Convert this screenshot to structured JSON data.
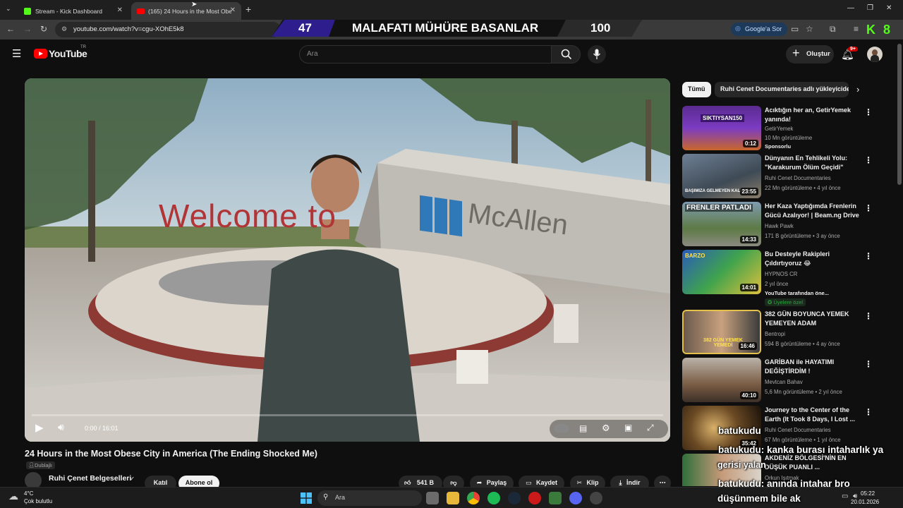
{
  "browser": {
    "tabs": [
      {
        "label": "Stream - Kick Dashboard",
        "active": false
      },
      {
        "label": "(165) 24 Hours in the Most Obe",
        "active": true
      }
    ],
    "url": "youtube.com/watch?v=cgu-XOhE5k8",
    "sor_button": "Google'a Sor"
  },
  "overlay_banner": {
    "left_value": "47",
    "text": "MALAFATI MÜHÜRE BASANLAR",
    "right_value": "100"
  },
  "youtube": {
    "logo": "YouTube",
    "region": "TR",
    "search_placeholder": "Ara",
    "create_label": "Oluştur",
    "notification_count": "9+"
  },
  "player": {
    "time": "0:00 / 16:01",
    "scene_text_left": "Welcome to",
    "scene_text_right": "McAllen"
  },
  "video": {
    "title": "24 Hours in the Most Obese City in America (The Ending Shocked Me)",
    "dubbed_label": "Dublajlı",
    "channel": "Ruhi Çenet Belgeselleri",
    "join_label": "Katıl",
    "subscribe_label": "Abone ol",
    "likes": "541 B",
    "share_label": "Paylaş",
    "save_label": "Kaydet",
    "clip_label": "Klip",
    "download_label": "İndir"
  },
  "sidebar": {
    "chips": [
      "Tümü",
      "Ruhi Cenet Documentaries adlı yükleyiciden"
    ],
    "recommendations": [
      {
        "title": "Acıktığın her an, GetirYemek yanında!",
        "channel": "GetirYemek",
        "meta": "10 Mn görüntüleme",
        "extra": "Sponsorlu",
        "duration": "0:12"
      },
      {
        "title": "Dünyanın En Tehlikeli Yolu: \"Karakurum Ölüm Geçidi\"",
        "channel": "Ruhi Cenet Documentaries",
        "meta": "22 Mn görüntüleme • 4 yıl önce",
        "extra": "",
        "duration": "23:55"
      },
      {
        "title": "Her Kaza Yaptığımda Frenlerin Gücü Azalıyor! | Beam.ng Drive",
        "channel": "Hawk Pawk",
        "meta": "171 B görüntüleme • 3 ay önce",
        "extra": "",
        "duration": "14:33"
      },
      {
        "title": "Bu Desteyle Rakipleri Çıldırtıyoruz 😂",
        "channel": "HYPNOS CR",
        "meta": "2 yıl önce",
        "extra": "YouTube tarafından öne...",
        "badge": "Üyelere özel",
        "duration": "14:01"
      },
      {
        "title": "382 GÜN BOYUNCA YEMEK YEMEYEN ADAM",
        "channel": "Bentropi",
        "meta": "594 B görüntüleme • 4 ay önce",
        "extra": "",
        "duration": "16:46"
      },
      {
        "title": "GARİBAN ile HAYATIMI DEĞİŞTİRDİM !",
        "channel": "Mevtcan Bahav",
        "meta": "5,6 Mn görüntüleme • 2 yıl önce",
        "extra": "",
        "duration": "40:10"
      },
      {
        "title": "Journey to the Center of the Earth (It Took 8 Days, I Lost ...",
        "channel": "Ruhi Cenet Documentaries",
        "meta": "67 Mn görüntüleme • 1 yıl önce",
        "extra": "",
        "duration": "35:42"
      },
      {
        "title": "AKDENİZ BÖLGESİ'NİN EN DÜŞÜK PUANLI ...",
        "channel": "Orkun Işıtmak",
        "meta": "",
        "extra": "",
        "duration": ""
      }
    ],
    "thumb_texts": [
      "SIKTIYSAN150",
      "BAŞIMIZA GELMEYEN KALMADI",
      "FRENLER PATLADI",
      "BARZO",
      "382 GÜN YEMEK YEMEDİ",
      "",
      "",
      ""
    ]
  },
  "chat_overlay": [
    {
      "user": "batukudu",
      "msg": ""
    },
    {
      "user": "batukudu",
      "msg": ": kanka burası intaharlık ya"
    },
    {
      "user": "",
      "msg": "gerisi yalan"
    },
    {
      "user": "batukudu",
      "msg": ": anında intahar bro"
    },
    {
      "user": "",
      "msg": "düşünmem bile ak"
    }
  ],
  "taskbar": {
    "weather_temp": "4°C",
    "weather_desc": "Çok bulutlu",
    "search_label": "Ara",
    "time": "05:22",
    "date": "20.01.2026"
  },
  "colors": {
    "yt_red": "#ff0000",
    "kick_green": "#53fc18",
    "banner_purple": "#2e1d8c"
  }
}
